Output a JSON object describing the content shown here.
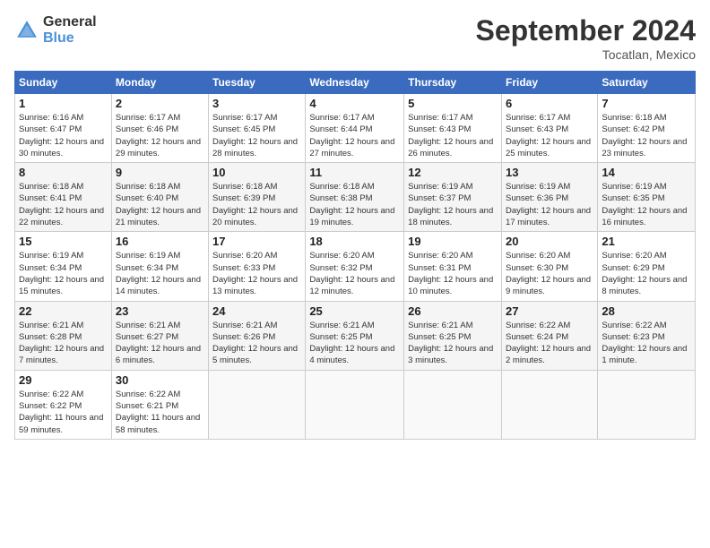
{
  "header": {
    "logo_general": "General",
    "logo_blue": "Blue",
    "title": "September 2024",
    "location": "Tocatlan, Mexico"
  },
  "days_of_week": [
    "Sunday",
    "Monday",
    "Tuesday",
    "Wednesday",
    "Thursday",
    "Friday",
    "Saturday"
  ],
  "weeks": [
    [
      {
        "day": "1",
        "info": "Sunrise: 6:16 AM\nSunset: 6:47 PM\nDaylight: 12 hours and 30 minutes."
      },
      {
        "day": "2",
        "info": "Sunrise: 6:17 AM\nSunset: 6:46 PM\nDaylight: 12 hours and 29 minutes."
      },
      {
        "day": "3",
        "info": "Sunrise: 6:17 AM\nSunset: 6:45 PM\nDaylight: 12 hours and 28 minutes."
      },
      {
        "day": "4",
        "info": "Sunrise: 6:17 AM\nSunset: 6:44 PM\nDaylight: 12 hours and 27 minutes."
      },
      {
        "day": "5",
        "info": "Sunrise: 6:17 AM\nSunset: 6:43 PM\nDaylight: 12 hours and 26 minutes."
      },
      {
        "day": "6",
        "info": "Sunrise: 6:17 AM\nSunset: 6:43 PM\nDaylight: 12 hours and 25 minutes."
      },
      {
        "day": "7",
        "info": "Sunrise: 6:18 AM\nSunset: 6:42 PM\nDaylight: 12 hours and 23 minutes."
      }
    ],
    [
      {
        "day": "8",
        "info": "Sunrise: 6:18 AM\nSunset: 6:41 PM\nDaylight: 12 hours and 22 minutes."
      },
      {
        "day": "9",
        "info": "Sunrise: 6:18 AM\nSunset: 6:40 PM\nDaylight: 12 hours and 21 minutes."
      },
      {
        "day": "10",
        "info": "Sunrise: 6:18 AM\nSunset: 6:39 PM\nDaylight: 12 hours and 20 minutes."
      },
      {
        "day": "11",
        "info": "Sunrise: 6:18 AM\nSunset: 6:38 PM\nDaylight: 12 hours and 19 minutes."
      },
      {
        "day": "12",
        "info": "Sunrise: 6:19 AM\nSunset: 6:37 PM\nDaylight: 12 hours and 18 minutes."
      },
      {
        "day": "13",
        "info": "Sunrise: 6:19 AM\nSunset: 6:36 PM\nDaylight: 12 hours and 17 minutes."
      },
      {
        "day": "14",
        "info": "Sunrise: 6:19 AM\nSunset: 6:35 PM\nDaylight: 12 hours and 16 minutes."
      }
    ],
    [
      {
        "day": "15",
        "info": "Sunrise: 6:19 AM\nSunset: 6:34 PM\nDaylight: 12 hours and 15 minutes."
      },
      {
        "day": "16",
        "info": "Sunrise: 6:19 AM\nSunset: 6:34 PM\nDaylight: 12 hours and 14 minutes."
      },
      {
        "day": "17",
        "info": "Sunrise: 6:20 AM\nSunset: 6:33 PM\nDaylight: 12 hours and 13 minutes."
      },
      {
        "day": "18",
        "info": "Sunrise: 6:20 AM\nSunset: 6:32 PM\nDaylight: 12 hours and 12 minutes."
      },
      {
        "day": "19",
        "info": "Sunrise: 6:20 AM\nSunset: 6:31 PM\nDaylight: 12 hours and 10 minutes."
      },
      {
        "day": "20",
        "info": "Sunrise: 6:20 AM\nSunset: 6:30 PM\nDaylight: 12 hours and 9 minutes."
      },
      {
        "day": "21",
        "info": "Sunrise: 6:20 AM\nSunset: 6:29 PM\nDaylight: 12 hours and 8 minutes."
      }
    ],
    [
      {
        "day": "22",
        "info": "Sunrise: 6:21 AM\nSunset: 6:28 PM\nDaylight: 12 hours and 7 minutes."
      },
      {
        "day": "23",
        "info": "Sunrise: 6:21 AM\nSunset: 6:27 PM\nDaylight: 12 hours and 6 minutes."
      },
      {
        "day": "24",
        "info": "Sunrise: 6:21 AM\nSunset: 6:26 PM\nDaylight: 12 hours and 5 minutes."
      },
      {
        "day": "25",
        "info": "Sunrise: 6:21 AM\nSunset: 6:25 PM\nDaylight: 12 hours and 4 minutes."
      },
      {
        "day": "26",
        "info": "Sunrise: 6:21 AM\nSunset: 6:25 PM\nDaylight: 12 hours and 3 minutes."
      },
      {
        "day": "27",
        "info": "Sunrise: 6:22 AM\nSunset: 6:24 PM\nDaylight: 12 hours and 2 minutes."
      },
      {
        "day": "28",
        "info": "Sunrise: 6:22 AM\nSunset: 6:23 PM\nDaylight: 12 hours and 1 minute."
      }
    ],
    [
      {
        "day": "29",
        "info": "Sunrise: 6:22 AM\nSunset: 6:22 PM\nDaylight: 11 hours and 59 minutes."
      },
      {
        "day": "30",
        "info": "Sunrise: 6:22 AM\nSunset: 6:21 PM\nDaylight: 11 hours and 58 minutes."
      },
      {
        "day": "",
        "info": ""
      },
      {
        "day": "",
        "info": ""
      },
      {
        "day": "",
        "info": ""
      },
      {
        "day": "",
        "info": ""
      },
      {
        "day": "",
        "info": ""
      }
    ]
  ]
}
